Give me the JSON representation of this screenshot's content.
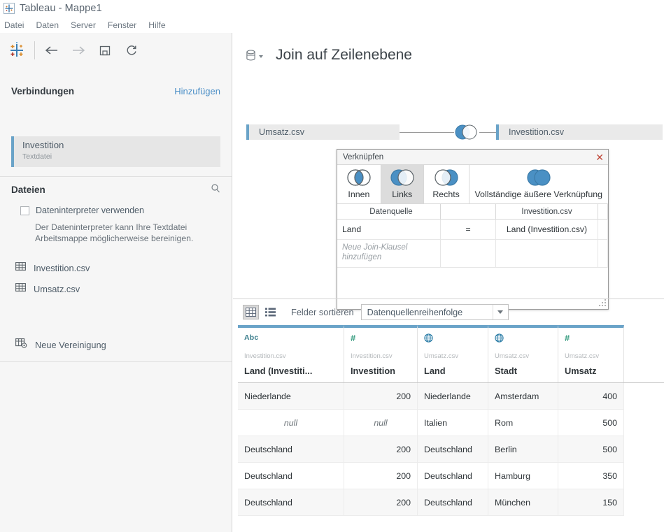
{
  "window": {
    "title": "Tableau - Mappe1",
    "logo_icon": "tableau-logo-icon"
  },
  "menubar": {
    "items": [
      {
        "label": "Datei",
        "name": "menu-datei"
      },
      {
        "label": "Daten",
        "name": "menu-daten"
      },
      {
        "label": "Server",
        "name": "menu-server"
      },
      {
        "label": "Fenster",
        "name": "menu-fenster"
      },
      {
        "label": "Hilfe",
        "name": "menu-hilfe"
      }
    ]
  },
  "toolbar": {
    "back_icon": "arrow-left-icon",
    "forward_icon": "arrow-right-icon",
    "save_icon": "save-disk-icon",
    "refresh_icon": "refresh-icon"
  },
  "sidebar": {
    "connections": {
      "title": "Verbindungen",
      "add_label": "Hinzufügen",
      "items": [
        {
          "name": "Investition",
          "type": "Textdatei"
        }
      ]
    },
    "files": {
      "title": "Dateien",
      "search_icon": "search-icon",
      "data_interpreter": {
        "label": "Dateninterpreter verwenden",
        "checked": false,
        "note": "Der Dateninterpreter kann Ihre Textdatei Arbeitsmappe möglicherweise bereinigen."
      },
      "items": [
        {
          "label": "Investition.csv",
          "icon": "table-icon"
        },
        {
          "label": "Umsatz.csv",
          "icon": "table-icon"
        }
      ],
      "new_union_label": "Neue Vereinigung",
      "new_union_icon": "new-union-icon"
    }
  },
  "canvas": {
    "title": "Join auf Zeilenebene",
    "title_icon": "database-icon",
    "flow": {
      "left_table": "Umsatz.csv",
      "right_table": "Investition.csv",
      "join_node_icon": "left-join-venn-icon"
    }
  },
  "join_dialog": {
    "title": "Verknüpfen",
    "close_icon": "close-icon",
    "types": [
      {
        "label": "Innen",
        "icon": "inner-join-venn-icon",
        "selected": false
      },
      {
        "label": "Links",
        "icon": "left-join-venn-icon",
        "selected": true
      },
      {
        "label": "Rechts",
        "icon": "right-join-venn-icon",
        "selected": false
      },
      {
        "label": "Vollständige äußere Verknüpfung",
        "icon": "full-outer-join-venn-icon",
        "selected": false
      }
    ],
    "columns": [
      "Datenquelle",
      "Investition.csv"
    ],
    "clauses": [
      {
        "left": "Land",
        "operator": "=",
        "right": "Land (Investition.csv)"
      }
    ],
    "add_clause_label": "Neue Join-Klausel hinzufügen",
    "resize_grip_icon": "resize-grip-icon"
  },
  "grid_toolbar": {
    "grid_view_icon": "grid-view-icon",
    "list_view_icon": "list-view-icon",
    "sort_label": "Felder sortieren",
    "sort_value": "Datenquellenreihenfolge",
    "dropdown_icon": "chevron-down-icon"
  },
  "data_grid": {
    "columns": [
      {
        "type_icon": "abc-text-icon",
        "type_label": "Abc",
        "source": "Investition.csv",
        "name": "Land (Investiti..."
      },
      {
        "type_icon": "number-icon",
        "type_label": "#",
        "source": "Investition.csv",
        "name": "Investition"
      },
      {
        "type_icon": "globe-geo-icon",
        "type_label": "globe",
        "source": "Umsatz.csv",
        "name": "Land"
      },
      {
        "type_icon": "globe-geo-icon",
        "type_label": "globe",
        "source": "Umsatz.csv",
        "name": "Stadt"
      },
      {
        "type_icon": "number-icon",
        "type_label": "#",
        "source": "Umsatz.csv",
        "name": "Umsatz"
      }
    ],
    "rows": [
      {
        "c0": "Niederlande",
        "c1": "200",
        "c2": "Niederlande",
        "c3": "Amsterdam",
        "c4": "400",
        "null0": false,
        "null1": false
      },
      {
        "c0": "null",
        "c1": "null",
        "c2": "Italien",
        "c3": "Rom",
        "c4": "500",
        "null0": true,
        "null1": true
      },
      {
        "c0": "Deutschland",
        "c1": "200",
        "c2": "Deutschland",
        "c3": "Berlin",
        "c4": "500",
        "null0": false,
        "null1": false
      },
      {
        "c0": "Deutschland",
        "c1": "200",
        "c2": "Deutschland",
        "c3": "Hamburg",
        "c4": "350",
        "null0": false,
        "null1": false
      },
      {
        "c0": "Deutschland",
        "c1": "200",
        "c2": "Deutschland",
        "c3": "München",
        "c4": "150",
        "null0": false,
        "null1": false
      }
    ]
  },
  "colors": {
    "accent_blue": "#4a90c4",
    "header_bar": "#6aa3c8",
    "link_blue": "#4b8fc7",
    "venn_blue": "#4a90c4"
  }
}
